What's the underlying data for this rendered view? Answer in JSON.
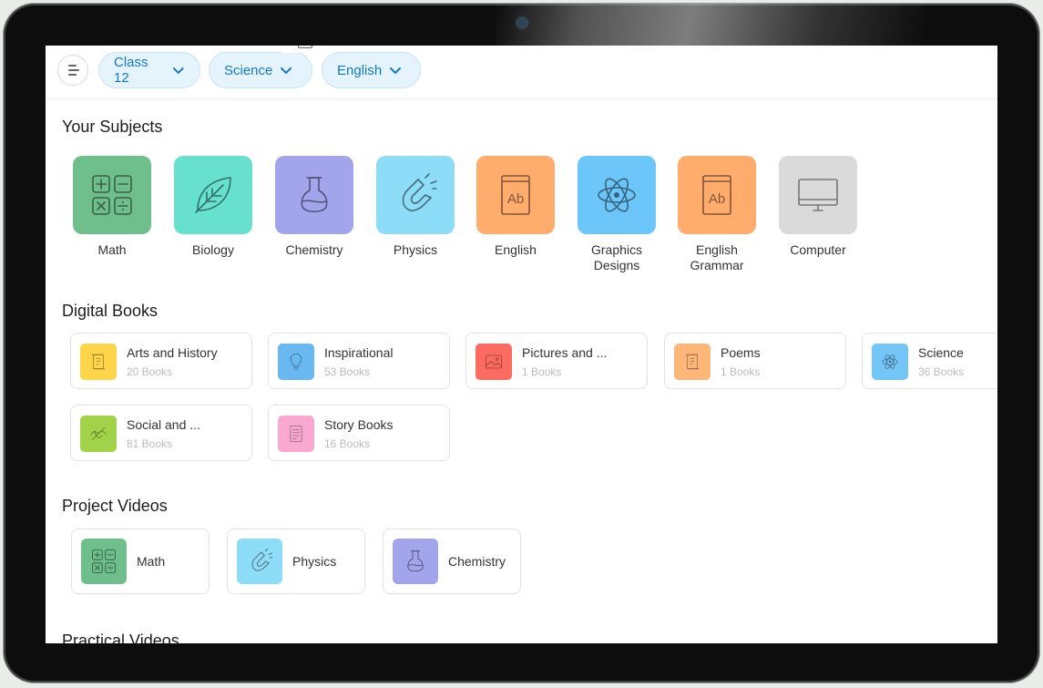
{
  "filters": [
    {
      "label": "Class 12"
    },
    {
      "label": "Science"
    },
    {
      "label": "English"
    }
  ],
  "sections": {
    "subjects_title": "Your Subjects",
    "books_title": "Digital Books",
    "videos_title": "Project Videos",
    "practical_title": "Practical Videos"
  },
  "subjects": [
    {
      "label": "Math",
      "icon": "math-icon",
      "color": "#6fbf8c"
    },
    {
      "label": "Biology",
      "icon": "leaf-icon",
      "color": "#67e0cf"
    },
    {
      "label": "Chemistry",
      "icon": "flask-icon",
      "color": "#a3a5ec"
    },
    {
      "label": "Physics",
      "icon": "magnet-icon",
      "color": "#8ddcf8"
    },
    {
      "label": "English",
      "icon": "book-ab-icon",
      "color": "#ffac6d"
    },
    {
      "label": "Graphics Designs",
      "icon": "atom-icon",
      "color": "#6cc6f9"
    },
    {
      "label": "English Grammar",
      "icon": "book-ab-icon",
      "color": "#ffac6d"
    },
    {
      "label": "Computer",
      "icon": "monitor-icon",
      "color": "#dadada"
    }
  ],
  "books": [
    {
      "title": "Arts and History",
      "count": "20 Books",
      "icon": "scroll-icon",
      "color": "#fdd44a"
    },
    {
      "title": "Inspirational",
      "count": "53 Books",
      "icon": "bulb-icon",
      "color": "#69b8f2"
    },
    {
      "title": "Pictures and ...",
      "count": "1 Books",
      "icon": "image-icon",
      "color": "#fb6b61"
    },
    {
      "title": "Poems",
      "count": "1 Books",
      "icon": "scroll-icon",
      "color": "#ffb679"
    },
    {
      "title": "Science",
      "count": "36 Books",
      "icon": "atom-icon",
      "color": "#74c6f7"
    },
    {
      "title": "Social and ...",
      "count": "81 Books",
      "icon": "handshake-icon",
      "color": "#a2d24a"
    },
    {
      "title": "Story Books",
      "count": "16 Books",
      "icon": "document-icon",
      "color": "#f9a9d0"
    }
  ],
  "videos": [
    {
      "label": "Math",
      "icon": "math-icon",
      "color": "#6fbf8c"
    },
    {
      "label": "Physics",
      "icon": "magnet-icon",
      "color": "#8ddcf8"
    },
    {
      "label": "Chemistry",
      "icon": "flask-icon",
      "color": "#a3a5ec"
    }
  ]
}
